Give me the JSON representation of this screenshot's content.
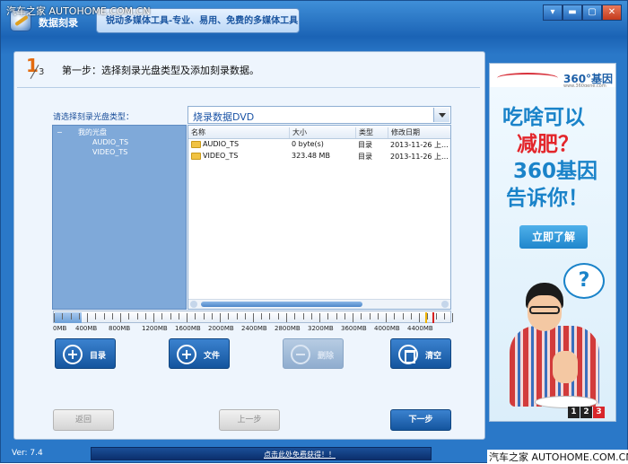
{
  "watermark_top": "汽车之家  AUTOHOME.COM.CN",
  "watermark_bottom": "汽车之家  AUTOHOME.COM.CN",
  "titlebar": {
    "app_title": "数据刻录",
    "tagline": "锐动多媒体工具-专业、易用、免费的多媒体工具",
    "buttons": [
      "▾",
      "▬",
      "▢",
      "✕"
    ]
  },
  "step": {
    "current": "1",
    "total": "3",
    "text": "第一步：选择刻录光盘类型及添加刻录数据。"
  },
  "tree": {
    "label": "请选择刻录光盘类型：",
    "root": "我的光盘",
    "expander": "−",
    "children": [
      "AUDIO_TS",
      "VIDEO_TS"
    ]
  },
  "disc_type": {
    "selected": "烧录数据DVD"
  },
  "file_list": {
    "columns": [
      "名称",
      "大小",
      "类型",
      "修改日期"
    ],
    "rows": [
      {
        "name": "AUDIO_TS",
        "size": "0 byte(s)",
        "type": "目录",
        "date": "2013-11-26 上..."
      },
      {
        "name": "VIDEO_TS",
        "size": "323.48 MB",
        "type": "目录",
        "date": "2013-11-26 上..."
      }
    ]
  },
  "capacity": {
    "labels": [
      "0MB",
      "400MB",
      "800MB",
      "1200MB",
      "1600MB",
      "2000MB",
      "2400MB",
      "2800MB",
      "3200MB",
      "3600MB",
      "4000MB",
      "4400MB"
    ],
    "used_mb": 323.48,
    "max_mb": 4800,
    "marker_yellow_mb": 4480,
    "marker_red_mb": 4560,
    "colors": {
      "fill": "#6b9fd8",
      "yellow": "#f0b400",
      "red": "#d62020"
    }
  },
  "actions": {
    "directory": "目录",
    "file": "文件",
    "delete": "删除",
    "clear": "清空"
  },
  "nav": {
    "back": "返回",
    "prev": "上一步",
    "next": "下一步"
  },
  "ad": {
    "logo": "360°基因",
    "logo_sub": "www.360gene.com",
    "line1": "吃啥可以",
    "line2": "减肥？",
    "line3": "360基因",
    "line4": "告诉你！",
    "cta": "立即了解",
    "bubble": "?",
    "pages": [
      "1",
      "2",
      "3"
    ],
    "active_page": "3"
  },
  "status": {
    "version": "Ver: 7.4",
    "promo": "点击此处免费获得！！"
  }
}
